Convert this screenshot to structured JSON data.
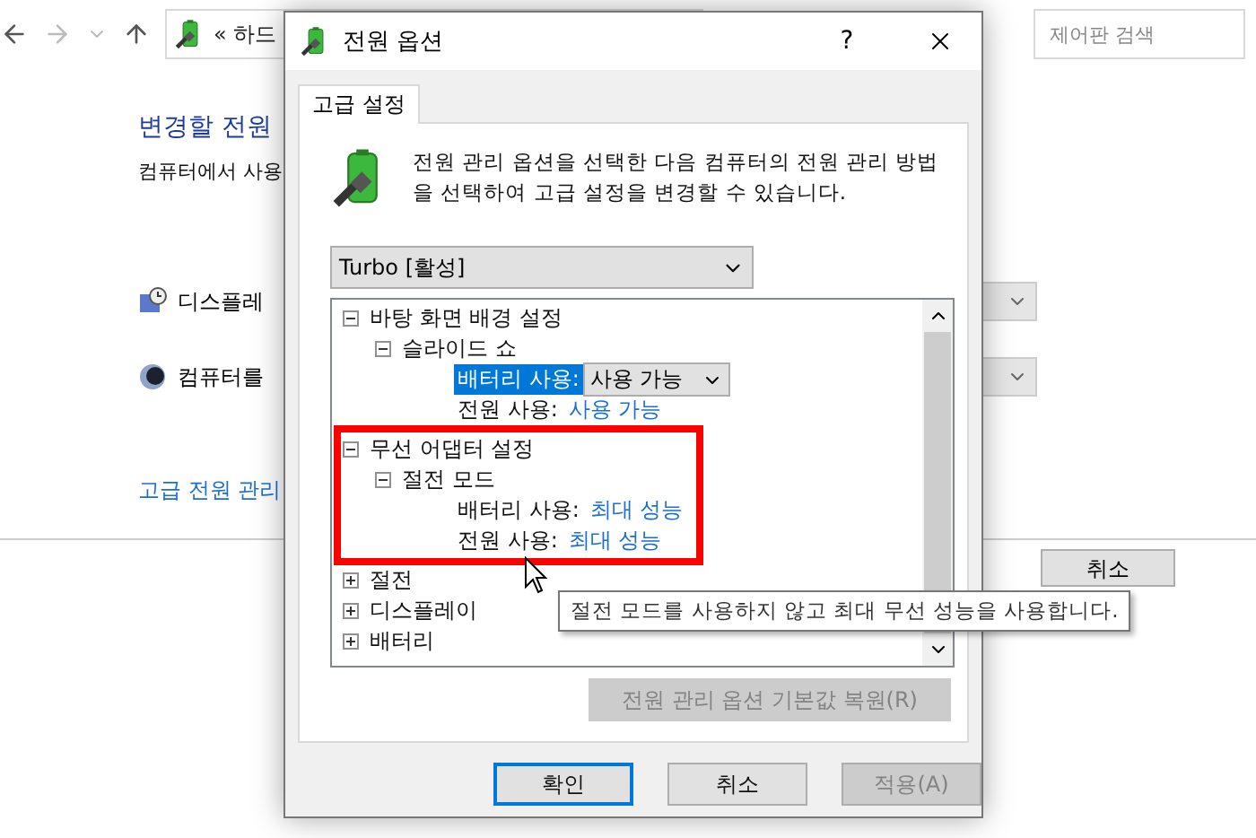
{
  "background": {
    "address": "« 하드",
    "search": {
      "placeholder": "제어판 검색"
    },
    "heading": "변경할 전원",
    "subtitle": "컴퓨터에서 사용",
    "settings": [
      {
        "kind": "display",
        "label": "디스플레"
      },
      {
        "kind": "sleep",
        "label": "컴퓨터를"
      }
    ],
    "link": "고급 전원 관리",
    "buttons": [
      "취소"
    ]
  },
  "window": {
    "title": "전원 옵션",
    "help": "?"
  },
  "tabs": [
    {
      "label": "고급 설정",
      "selected": true
    }
  ],
  "description": "전원 관리 옵션을 선택한 다음 컴퓨터의 전원 관리 방법을 선택하여 고급 설정을 변경할 수 있습니다.",
  "plan": "Turbo [활성]",
  "tree": [
    {
      "kind": "group",
      "label": "바탕 화면 배경 설정",
      "expanded": true,
      "highlighted": false,
      "children": [
        {
          "kind": "group",
          "label": "슬라이드 쇼",
          "expanded": true,
          "highlighted": false,
          "children": [
            {
              "kind": "dropdown",
              "label": "배터리 사용:",
              "value": "사용 가능",
              "selected": true
            },
            {
              "kind": "value",
              "label": "전원 사용:",
              "value": "사용 가능",
              "selected": false
            }
          ]
        }
      ]
    },
    {
      "kind": "group",
      "label": "무선 어댑터 설정",
      "expanded": true,
      "highlighted": true,
      "children": [
        {
          "kind": "group",
          "label": "절전 모드",
          "expanded": true,
          "highlighted": false,
          "children": [
            {
              "kind": "value",
              "label": "배터리 사용:",
              "value": "최대 성능",
              "selected": false
            },
            {
              "kind": "value",
              "label": "전원 사용:",
              "value": "최대 성능",
              "selected": false
            }
          ]
        }
      ]
    },
    {
      "kind": "group",
      "label": "절전",
      "expanded": false,
      "highlighted": false
    },
    {
      "kind": "group",
      "label": "디스플레이",
      "expanded": false,
      "highlighted": false
    },
    {
      "kind": "group",
      "label": "배터리",
      "expanded": false,
      "highlighted": false
    }
  ],
  "tooltip": "절전 모드를 사용하지 않고 최대 무선 성능을 사용합니다.",
  "restore_button": {
    "label": "전원 관리 옵션 기본값 복원(R)",
    "disabled": true
  },
  "buttons": [
    {
      "label": "확인",
      "default": true,
      "disabled": false
    },
    {
      "label": "취소",
      "default": false,
      "disabled": false
    },
    {
      "label": "적용(A)",
      "default": false,
      "disabled": true
    }
  ]
}
